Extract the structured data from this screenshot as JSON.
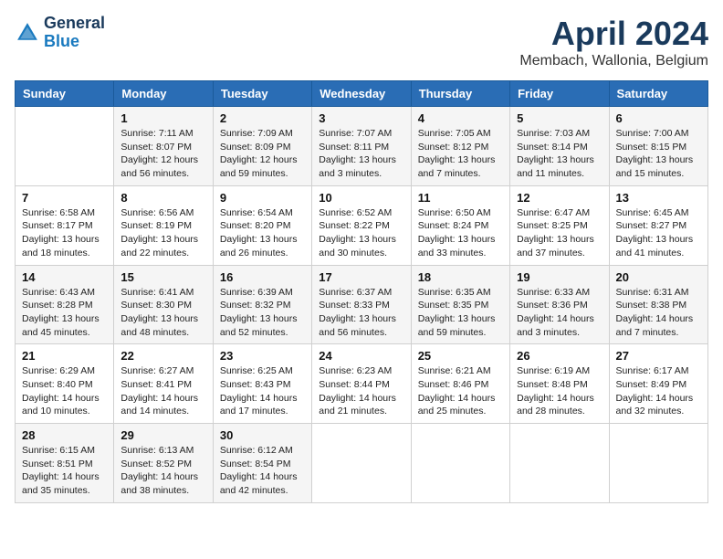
{
  "header": {
    "logo_line1": "General",
    "logo_line2": "Blue",
    "title": "April 2024",
    "subtitle": "Membach, Wallonia, Belgium"
  },
  "weekdays": [
    "Sunday",
    "Monday",
    "Tuesday",
    "Wednesday",
    "Thursday",
    "Friday",
    "Saturday"
  ],
  "weeks": [
    [
      {
        "day": "",
        "info": ""
      },
      {
        "day": "1",
        "info": "Sunrise: 7:11 AM\nSunset: 8:07 PM\nDaylight: 12 hours\nand 56 minutes."
      },
      {
        "day": "2",
        "info": "Sunrise: 7:09 AM\nSunset: 8:09 PM\nDaylight: 12 hours\nand 59 minutes."
      },
      {
        "day": "3",
        "info": "Sunrise: 7:07 AM\nSunset: 8:11 PM\nDaylight: 13 hours\nand 3 minutes."
      },
      {
        "day": "4",
        "info": "Sunrise: 7:05 AM\nSunset: 8:12 PM\nDaylight: 13 hours\nand 7 minutes."
      },
      {
        "day": "5",
        "info": "Sunrise: 7:03 AM\nSunset: 8:14 PM\nDaylight: 13 hours\nand 11 minutes."
      },
      {
        "day": "6",
        "info": "Sunrise: 7:00 AM\nSunset: 8:15 PM\nDaylight: 13 hours\nand 15 minutes."
      }
    ],
    [
      {
        "day": "7",
        "info": "Sunrise: 6:58 AM\nSunset: 8:17 PM\nDaylight: 13 hours\nand 18 minutes."
      },
      {
        "day": "8",
        "info": "Sunrise: 6:56 AM\nSunset: 8:19 PM\nDaylight: 13 hours\nand 22 minutes."
      },
      {
        "day": "9",
        "info": "Sunrise: 6:54 AM\nSunset: 8:20 PM\nDaylight: 13 hours\nand 26 minutes."
      },
      {
        "day": "10",
        "info": "Sunrise: 6:52 AM\nSunset: 8:22 PM\nDaylight: 13 hours\nand 30 minutes."
      },
      {
        "day": "11",
        "info": "Sunrise: 6:50 AM\nSunset: 8:24 PM\nDaylight: 13 hours\nand 33 minutes."
      },
      {
        "day": "12",
        "info": "Sunrise: 6:47 AM\nSunset: 8:25 PM\nDaylight: 13 hours\nand 37 minutes."
      },
      {
        "day": "13",
        "info": "Sunrise: 6:45 AM\nSunset: 8:27 PM\nDaylight: 13 hours\nand 41 minutes."
      }
    ],
    [
      {
        "day": "14",
        "info": "Sunrise: 6:43 AM\nSunset: 8:28 PM\nDaylight: 13 hours\nand 45 minutes."
      },
      {
        "day": "15",
        "info": "Sunrise: 6:41 AM\nSunset: 8:30 PM\nDaylight: 13 hours\nand 48 minutes."
      },
      {
        "day": "16",
        "info": "Sunrise: 6:39 AM\nSunset: 8:32 PM\nDaylight: 13 hours\nand 52 minutes."
      },
      {
        "day": "17",
        "info": "Sunrise: 6:37 AM\nSunset: 8:33 PM\nDaylight: 13 hours\nand 56 minutes."
      },
      {
        "day": "18",
        "info": "Sunrise: 6:35 AM\nSunset: 8:35 PM\nDaylight: 13 hours\nand 59 minutes."
      },
      {
        "day": "19",
        "info": "Sunrise: 6:33 AM\nSunset: 8:36 PM\nDaylight: 14 hours\nand 3 minutes."
      },
      {
        "day": "20",
        "info": "Sunrise: 6:31 AM\nSunset: 8:38 PM\nDaylight: 14 hours\nand 7 minutes."
      }
    ],
    [
      {
        "day": "21",
        "info": "Sunrise: 6:29 AM\nSunset: 8:40 PM\nDaylight: 14 hours\nand 10 minutes."
      },
      {
        "day": "22",
        "info": "Sunrise: 6:27 AM\nSunset: 8:41 PM\nDaylight: 14 hours\nand 14 minutes."
      },
      {
        "day": "23",
        "info": "Sunrise: 6:25 AM\nSunset: 8:43 PM\nDaylight: 14 hours\nand 17 minutes."
      },
      {
        "day": "24",
        "info": "Sunrise: 6:23 AM\nSunset: 8:44 PM\nDaylight: 14 hours\nand 21 minutes."
      },
      {
        "day": "25",
        "info": "Sunrise: 6:21 AM\nSunset: 8:46 PM\nDaylight: 14 hours\nand 25 minutes."
      },
      {
        "day": "26",
        "info": "Sunrise: 6:19 AM\nSunset: 8:48 PM\nDaylight: 14 hours\nand 28 minutes."
      },
      {
        "day": "27",
        "info": "Sunrise: 6:17 AM\nSunset: 8:49 PM\nDaylight: 14 hours\nand 32 minutes."
      }
    ],
    [
      {
        "day": "28",
        "info": "Sunrise: 6:15 AM\nSunset: 8:51 PM\nDaylight: 14 hours\nand 35 minutes."
      },
      {
        "day": "29",
        "info": "Sunrise: 6:13 AM\nSunset: 8:52 PM\nDaylight: 14 hours\nand 38 minutes."
      },
      {
        "day": "30",
        "info": "Sunrise: 6:12 AM\nSunset: 8:54 PM\nDaylight: 14 hours\nand 42 minutes."
      },
      {
        "day": "",
        "info": ""
      },
      {
        "day": "",
        "info": ""
      },
      {
        "day": "",
        "info": ""
      },
      {
        "day": "",
        "info": ""
      }
    ]
  ]
}
